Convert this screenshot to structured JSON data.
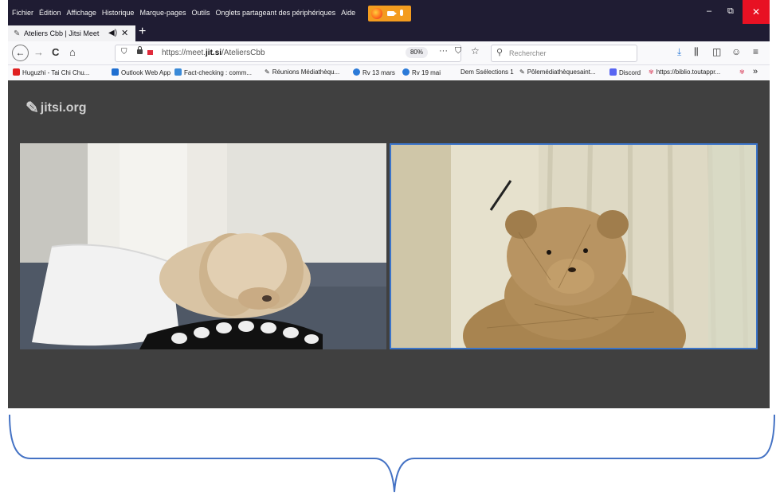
{
  "menu": [
    "Fichier",
    "Édition",
    "Affichage",
    "Historique",
    "Marque-pages",
    "Outils",
    "Onglets partageant des périphériques",
    "Aide"
  ],
  "window_controls": {
    "minimize": "–",
    "restore": "⧉",
    "close": "✕"
  },
  "tab": {
    "title": "Ateliers Cbb | Jitsi Meet",
    "audio_icon": "◀)",
    "close": "✕",
    "new_tab": "+"
  },
  "nav": {
    "back": "←",
    "forward": "→",
    "reload": "C",
    "home": "⌂"
  },
  "urlbar": {
    "url_prefix": "https://meet.",
    "url_domain": "jit.si",
    "url_path": "/AteliersCbb",
    "zoom": "80%",
    "more": "···"
  },
  "search": {
    "placeholder": "Rechercher"
  },
  "bookmarks": [
    {
      "label": "Huguzhi - Tai Chi Chu...",
      "color": "#e02020"
    },
    {
      "label": "Outlook Web App",
      "color": "#1f6fd1"
    },
    {
      "label": "Fact-checking : comm...",
      "color": "#3a8ad8"
    },
    {
      "label": "Réunions Médiathèqu...",
      "color": "#777777"
    },
    {
      "label": "Rv 13 mars",
      "color": "#2b7ad8"
    },
    {
      "label": "Rv 19 mai",
      "color": "#2b7ad8"
    },
    {
      "label": "Dem Ssélections 1",
      "color": ""
    },
    {
      "label": "Pôlemédiathèquesaint...",
      "color": "#777777"
    },
    {
      "label": "Discord",
      "color": "#5865f2"
    },
    {
      "label": "https://biblio.toutappr...",
      "color": "#e06a80"
    }
  ],
  "bookmarks_more": "»",
  "jitsi": {
    "logo_text": "jitsi.org"
  },
  "colors": {
    "titlebar": "#1f1c33",
    "content_bg": "#404040",
    "active_speaker": "#3b74c9",
    "brace": "#4472c4",
    "close_red": "#e81123",
    "sharing_orange": "#f39c1f"
  }
}
